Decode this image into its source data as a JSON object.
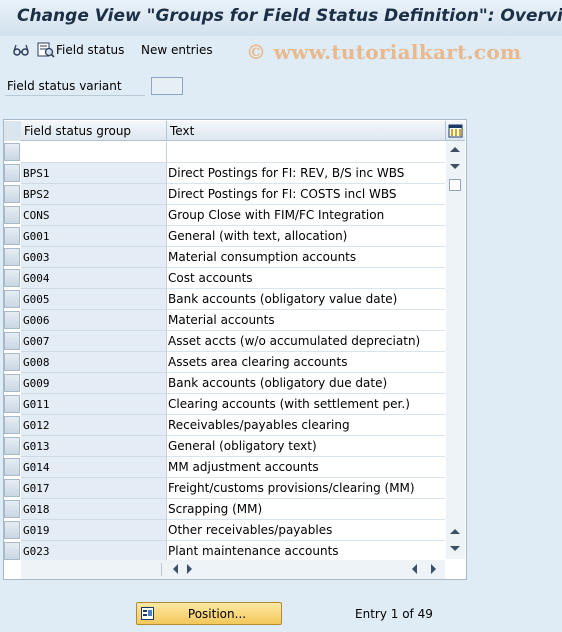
{
  "window": {
    "title": "Change View \"Groups for Field Status Definition\": Overview"
  },
  "toolbar": {
    "field_status_label": "Field status",
    "new_entries_label": "New entries",
    "icons": [
      "glasses-icon",
      "field-status-icon"
    ]
  },
  "watermark": "© www.tutorialkart.com",
  "selection": {
    "field_status_variant_label": "Field status variant",
    "field_status_variant_value": ""
  },
  "table": {
    "columns": [
      "Field status group",
      "Text"
    ],
    "rows": [
      {
        "group": "",
        "text": ""
      },
      {
        "group": "BPS1",
        "text": "Direct Postings for FI: REV, B/S inc WBS"
      },
      {
        "group": "BPS2",
        "text": "Direct Postings for FI: COSTS incl WBS"
      },
      {
        "group": "CONS",
        "text": "Group Close with FIM/FC Integration"
      },
      {
        "group": "G001",
        "text": "General (with text, allocation)"
      },
      {
        "group": "G003",
        "text": "Material consumption accounts"
      },
      {
        "group": "G004",
        "text": "Cost accounts"
      },
      {
        "group": "G005",
        "text": "Bank accounts (obligatory value date)"
      },
      {
        "group": "G006",
        "text": "Material accounts"
      },
      {
        "group": "G007",
        "text": "Asset accts (w/o accumulated depreciatn)"
      },
      {
        "group": "G008",
        "text": "Assets area clearing accounts"
      },
      {
        "group": "G009",
        "text": "Bank accounts (obligatory due date)"
      },
      {
        "group": "G011",
        "text": "Clearing accounts (with settlement per.)"
      },
      {
        "group": "G012",
        "text": "Receivables/payables clearing"
      },
      {
        "group": "G013",
        "text": "General (obligatory text)"
      },
      {
        "group": "G014",
        "text": "MM adjustment accounts"
      },
      {
        "group": "G017",
        "text": "Freight/customs provisions/clearing (MM)"
      },
      {
        "group": "G018",
        "text": "Scrapping (MM)"
      },
      {
        "group": "G019",
        "text": "Other receivables/payables"
      },
      {
        "group": "G023",
        "text": "Plant maintenance accounts"
      }
    ]
  },
  "footer": {
    "position_button_label": "Position...",
    "entry_text": "Entry 1 of 49"
  },
  "colors": {
    "background": "#dfebf5",
    "title_text": "#1b2f47",
    "watermark": "#e8b98e",
    "button_yellow": "#f4c85a"
  }
}
